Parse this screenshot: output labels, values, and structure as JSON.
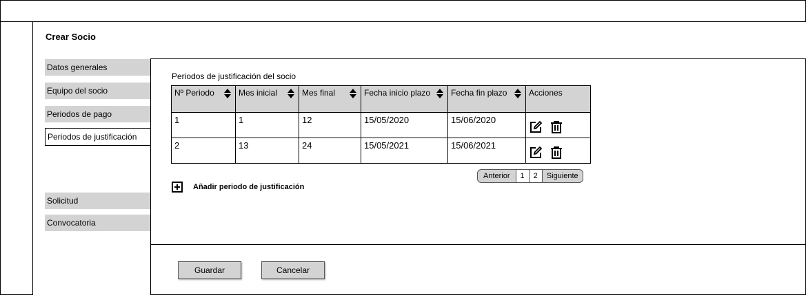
{
  "page_title": "Crear Socio",
  "nav": {
    "items": [
      {
        "label": "Datos generales"
      },
      {
        "label": "Equipo del socio"
      },
      {
        "label": "Periodos de pago"
      },
      {
        "label": "Periodos de justificación",
        "active": true
      },
      {
        "label": "Solicitud"
      },
      {
        "label": "Convocatoria"
      }
    ]
  },
  "section_label": "Periodos de justificación del socio",
  "table": {
    "columns": [
      "Nº Periodo",
      "Mes inicial",
      "Mes final",
      "Fecha inicio plazo",
      "Fecha fin plazo",
      "Acciones"
    ],
    "rows": [
      [
        "1",
        "1",
        "12",
        "15/05/2020",
        "15/06/2020"
      ],
      [
        "2",
        "13",
        "24",
        "15/05/2021",
        "15/06/2021"
      ]
    ]
  },
  "pager": {
    "prev": "Anterior",
    "pages": [
      "1",
      "2"
    ],
    "next": "Siguiente"
  },
  "add_label": "Añadir periodo de justificación",
  "buttons": {
    "save": "Guardar",
    "cancel": "Cancelar"
  },
  "icons": [
    "sort-icon",
    "edit-icon",
    "delete-icon",
    "add-icon"
  ]
}
